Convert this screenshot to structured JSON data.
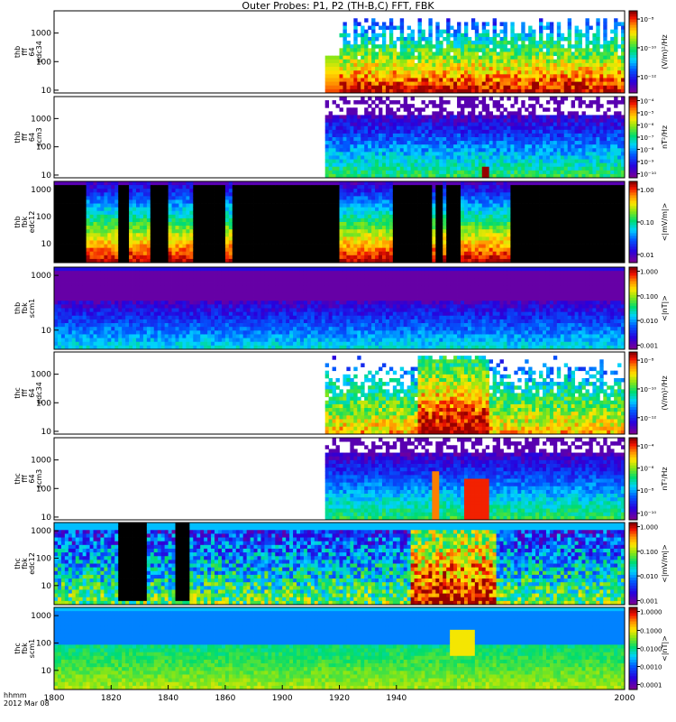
{
  "title": "Outer Probes: P1, P2 (TH-B,C) FFT, FBK",
  "x_axis": {
    "ticks": [
      "1800",
      "1820",
      "1840",
      "1860",
      "1900",
      "1920",
      "1940",
      "2000"
    ],
    "tick_values": [
      1800,
      1820,
      1840,
      1860,
      1900,
      1920,
      1940,
      2000
    ],
    "label_line1": "hhmm",
    "label_line2": "2012 Mar 08"
  },
  "chart_data": [
    {
      "type": "heatmap",
      "ylabel": [
        "thb",
        "fff",
        "64",
        "edc34"
      ],
      "yscale": "log",
      "ylim": [
        8,
        6000
      ],
      "yticks": [
        "1000",
        "100",
        "10"
      ],
      "ytick_values": [
        1000,
        100,
        10
      ],
      "colorbar_label": "(V/m)²/Hz",
      "colorbar_ticks": [
        "10⁻⁸",
        "10⁻¹⁰",
        "10⁻¹²"
      ],
      "colorbar_tick_positions": [
        0.9,
        0.55,
        0.2
      ],
      "data_start_x": 1895,
      "pattern": "bursty_high"
    },
    {
      "type": "heatmap",
      "ylabel": [
        "thb",
        "fff",
        "64",
        "scm3"
      ],
      "yscale": "log",
      "ylim": [
        8,
        6000
      ],
      "yticks": [
        "1000",
        "100",
        "10"
      ],
      "ytick_values": [
        1000,
        100,
        10
      ],
      "colorbar_label": "nT²/Hz",
      "colorbar_ticks": [
        "10⁻⁴",
        "10⁻⁵",
        "10⁻⁶",
        "10⁻⁷",
        "10⁻⁸",
        "10⁻⁹",
        "10⁻¹⁰"
      ],
      "colorbar_tick_positions": [
        0.95,
        0.8,
        0.65,
        0.5,
        0.35,
        0.2,
        0.05
      ],
      "data_start_x": 1895,
      "pattern": "banded_noise"
    },
    {
      "type": "heatmap",
      "ylabel": [
        "thb",
        "fbk",
        "edc12"
      ],
      "yscale": "log",
      "ylim": [
        2,
        2000
      ],
      "yticks": [
        "1000",
        "100",
        "10"
      ],
      "ytick_values": [
        1000,
        100,
        10
      ],
      "colorbar_label": "<|mV/m|>",
      "colorbar_ticks": [
        "1.00",
        "0.10",
        "0.01"
      ],
      "colorbar_tick_positions": [
        0.9,
        0.5,
        0.1
      ],
      "data_start_x": 1800,
      "pattern": "gapped_bands",
      "active_intervals": [
        [
          1811,
          1823
        ],
        [
          1826,
          1834
        ],
        [
          1837,
          1838
        ],
        [
          1840,
          1849
        ],
        [
          1860,
          1863
        ],
        [
          1900,
          1919
        ],
        [
          1933,
          1934
        ],
        [
          1936,
          1937
        ],
        [
          1943,
          1960
        ]
      ]
    },
    {
      "type": "heatmap",
      "ylabel": [
        "thb",
        "fbk",
        "scm1"
      ],
      "yscale": "log",
      "ylim": [
        2,
        2000
      ],
      "yticks": [
        "1000",
        "10"
      ],
      "ytick_values": [
        1000,
        10
      ],
      "colorbar_label": "<|nT|>",
      "colorbar_ticks": [
        "1.000",
        "0.100",
        "0.010",
        "0.001"
      ],
      "colorbar_tick_positions": [
        0.95,
        0.65,
        0.35,
        0.05
      ],
      "data_start_x": 1800,
      "pattern": "quiet_low"
    },
    {
      "type": "heatmap",
      "ylabel": [
        "thc",
        "fff",
        "64",
        "edc34"
      ],
      "yscale": "log",
      "ylim": [
        8,
        6000
      ],
      "yticks": [
        "1000",
        "100",
        "10"
      ],
      "ytick_values": [
        1000,
        100,
        10
      ],
      "colorbar_label": "(V/m)²/Hz",
      "colorbar_ticks": [
        "10⁻⁸",
        "10⁻¹⁰",
        "10⁻¹²"
      ],
      "colorbar_tick_positions": [
        0.9,
        0.55,
        0.2
      ],
      "data_start_x": 1895,
      "pattern": "bursty_active"
    },
    {
      "type": "heatmap",
      "ylabel": [
        "thc",
        "fff",
        "64",
        "scm3"
      ],
      "yscale": "log",
      "ylim": [
        8,
        6000
      ],
      "yticks": [
        "1000",
        "100",
        "10"
      ],
      "ytick_values": [
        1000,
        100,
        10
      ],
      "colorbar_label": "nT²/Hz",
      "colorbar_ticks": [
        "10⁻⁴",
        "10⁻⁶",
        "10⁻⁸",
        "10⁻¹⁰"
      ],
      "colorbar_tick_positions": [
        0.9,
        0.63,
        0.36,
        0.08
      ],
      "data_start_x": 1895,
      "pattern": "banded_event"
    },
    {
      "type": "heatmap",
      "ylabel": [
        "thc",
        "fbk",
        "edc12"
      ],
      "yscale": "log",
      "ylim": [
        2,
        2000
      ],
      "yticks": [
        "1000",
        "100",
        "10"
      ],
      "ytick_values": [
        1000,
        100,
        10
      ],
      "colorbar_label": "<|mV/m|>",
      "colorbar_ticks": [
        "1.000",
        "0.100",
        "0.010",
        "0.001"
      ],
      "colorbar_tick_positions": [
        0.95,
        0.65,
        0.35,
        0.05
      ],
      "data_start_x": 1800,
      "pattern": "mixed_active",
      "black_intervals": [
        [
          1822,
          1833
        ],
        [
          1843,
          1848
        ]
      ]
    },
    {
      "type": "heatmap",
      "ylabel": [
        "thc",
        "fbk",
        "scm1"
      ],
      "yscale": "log",
      "ylim": [
        2,
        2000
      ],
      "yticks": [
        "1000",
        "100",
        "10"
      ],
      "ytick_values": [
        1000,
        100,
        10
      ],
      "colorbar_label": "<|nT|>",
      "colorbar_ticks": [
        "1.0000",
        "0.1000",
        "0.0100",
        "0.0010",
        "0.0001"
      ],
      "colorbar_tick_positions": [
        0.95,
        0.72,
        0.5,
        0.28,
        0.06
      ],
      "data_start_x": 1800,
      "pattern": "flat_bands"
    }
  ]
}
